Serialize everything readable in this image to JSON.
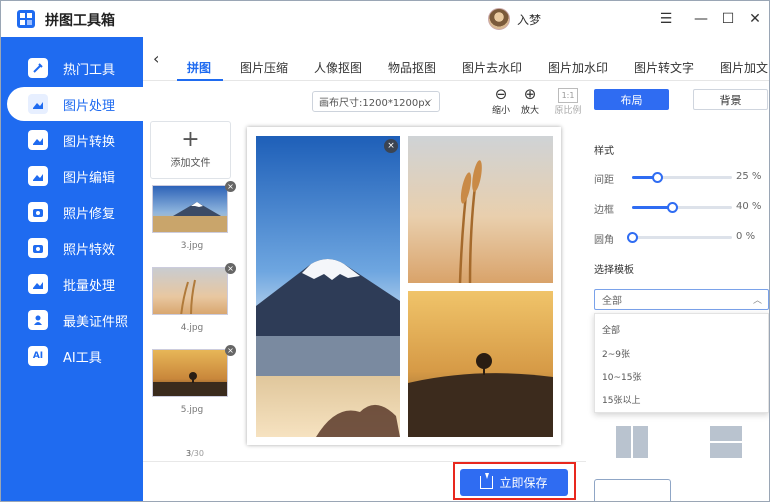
{
  "app": {
    "title": "拼图工具箱",
    "user": "入梦",
    "window": {
      "menu": "☰",
      "minimize": "—",
      "maximize": "☐",
      "close": "✕"
    }
  },
  "sidebar": {
    "items": [
      {
        "label": "热门工具",
        "icon": "toolkit-icon"
      },
      {
        "label": "图片处理",
        "icon": "image-process-icon",
        "active": true
      },
      {
        "label": "图片转换",
        "icon": "image-convert-icon"
      },
      {
        "label": "图片编辑",
        "icon": "image-edit-icon"
      },
      {
        "label": "照片修复",
        "icon": "photo-repair-icon"
      },
      {
        "label": "照片特效",
        "icon": "photo-effect-icon"
      },
      {
        "label": "批量处理",
        "icon": "batch-icon"
      },
      {
        "label": "最美证件照",
        "icon": "id-photo-icon"
      },
      {
        "label": "AI工具",
        "icon": "ai-icon"
      }
    ]
  },
  "tabs": {
    "back": "‹",
    "items": [
      "拼图",
      "图片压缩",
      "人像抠图",
      "物品抠图",
      "图片去水印",
      "图片加水印",
      "图片转文字",
      "图片加文"
    ],
    "active": 0
  },
  "toolbar": {
    "canvas_size": "画布尺寸:1200*1200px",
    "zoom_out": "缩小",
    "zoom_in": "放大",
    "ratio": "原比例",
    "ratio_value": "1:1"
  },
  "files": {
    "add_label": "添加文件",
    "add_symbol": "+",
    "items": [
      {
        "name": "3.jpg"
      },
      {
        "name": "4.jpg"
      },
      {
        "name": "5.jpg"
      }
    ],
    "count": "3",
    "total": "/30"
  },
  "save": {
    "label": "立即保存"
  },
  "right": {
    "tab_layout": "布局",
    "tab_background": "背景",
    "style_title": "样式",
    "sliders": [
      {
        "label": "间距",
        "value": "25",
        "unit": "%",
        "pct": 0.25
      },
      {
        "label": "边框",
        "value": "40",
        "unit": "%",
        "pct": 0.4
      },
      {
        "label": "圆角",
        "value": "0",
        "unit": "%",
        "pct": 0
      }
    ],
    "template_title": "选择模板",
    "template_selected": "全部",
    "template_options": [
      "全部",
      "2~9张",
      "10~15张",
      "15张以上"
    ]
  },
  "colors": {
    "accent": "#1f6bf0",
    "save_outline": "#e8281e"
  }
}
